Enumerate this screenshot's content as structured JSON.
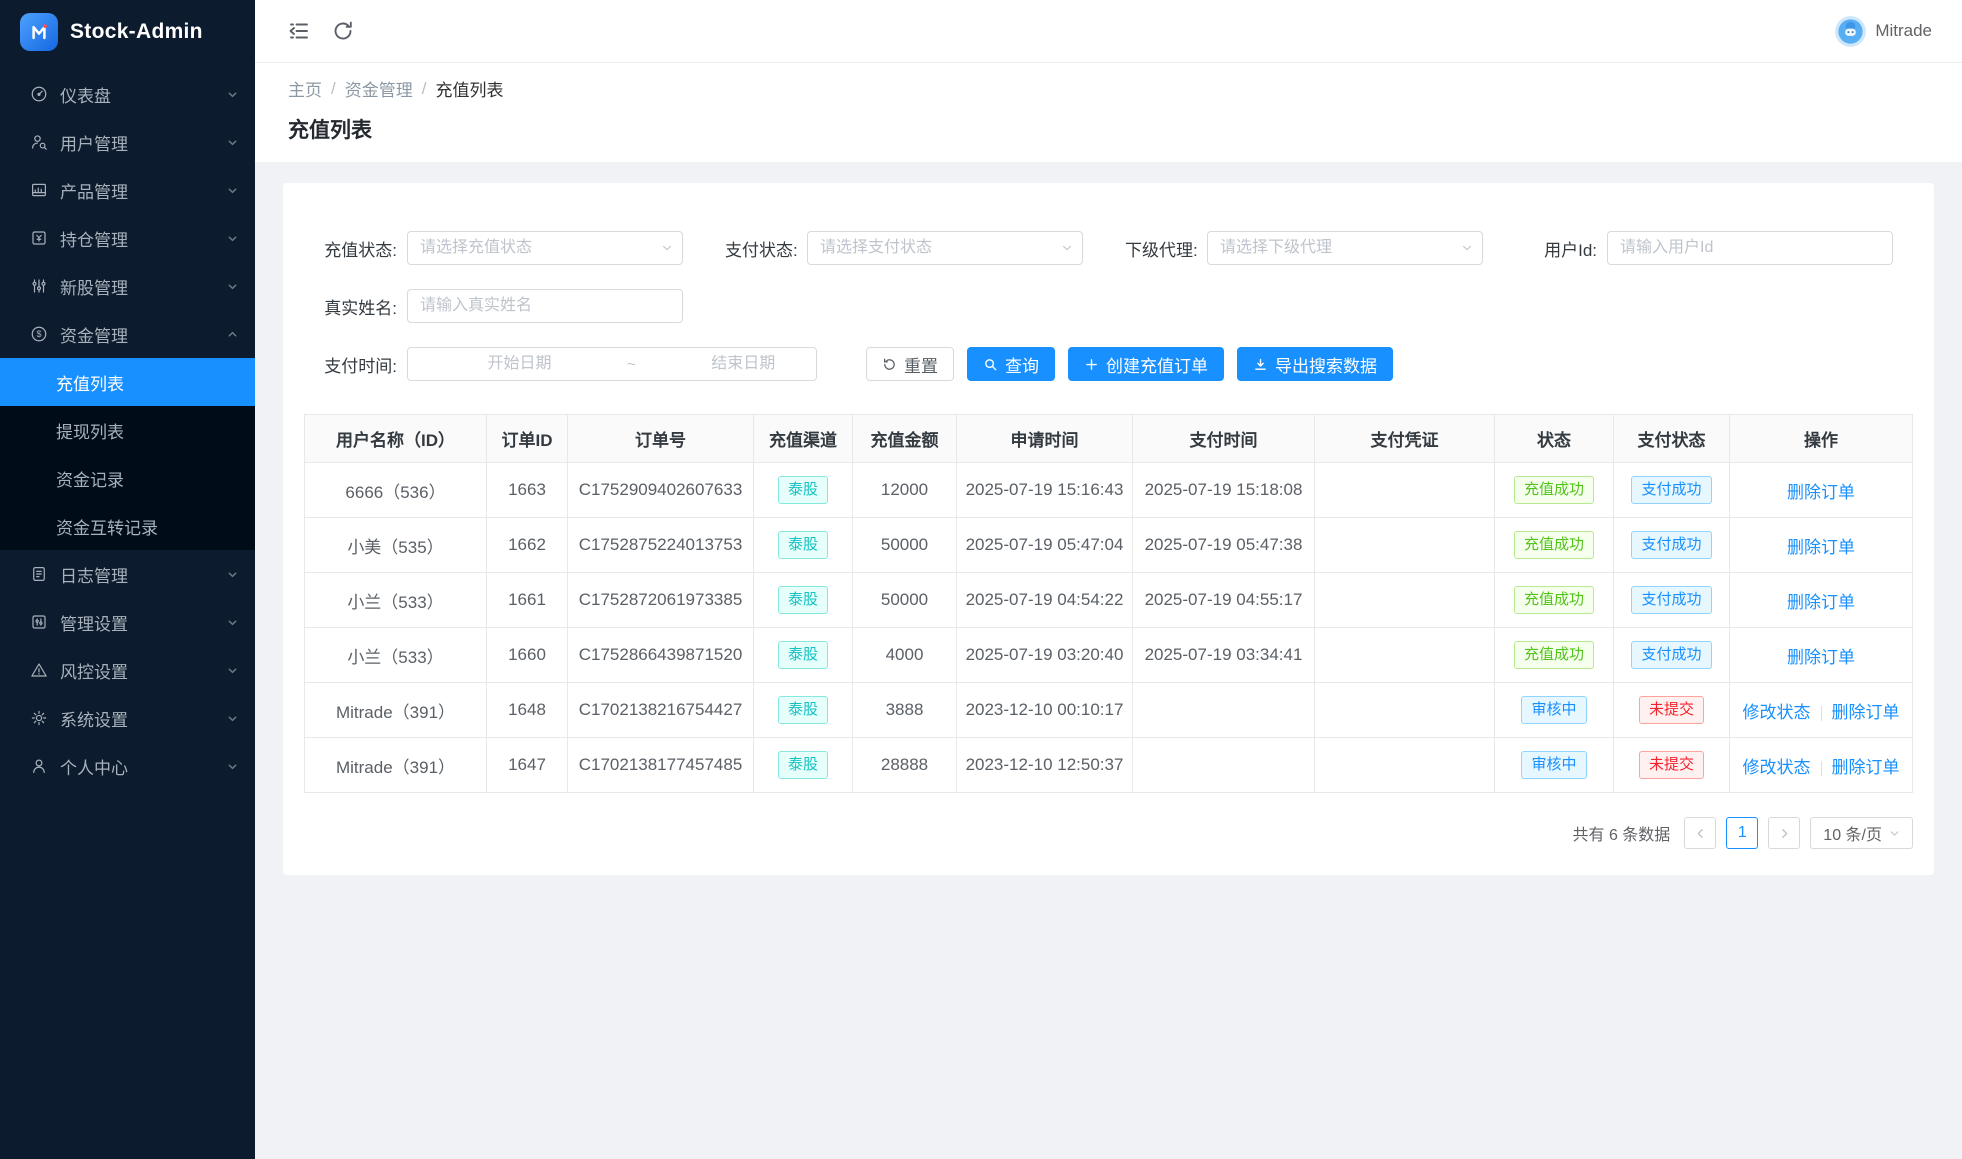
{
  "app": {
    "name": "Stock-Admin"
  },
  "topbar": {
    "username": "Mitrade"
  },
  "breadcrumb": {
    "items": [
      "主页",
      "资金管理",
      "充值列表"
    ],
    "separator": "/"
  },
  "page": {
    "title": "充值列表"
  },
  "sidebar": {
    "items": [
      {
        "label": "仪表盘"
      },
      {
        "label": "用户管理"
      },
      {
        "label": "产品管理"
      },
      {
        "label": "持仓管理"
      },
      {
        "label": "新股管理"
      },
      {
        "label": "资金管理"
      },
      {
        "label": "日志管理"
      },
      {
        "label": "管理设置"
      },
      {
        "label": "风控设置"
      },
      {
        "label": "系统设置"
      },
      {
        "label": "个人中心"
      }
    ],
    "funds_submenu": [
      {
        "label": "充值列表",
        "active": true
      },
      {
        "label": "提现列表",
        "active": false
      },
      {
        "label": "资金记录",
        "active": false
      },
      {
        "label": "资金互转记录",
        "active": false
      }
    ]
  },
  "filters": {
    "recharge_status": {
      "label": "充值状态:",
      "placeholder": "请选择充值状态"
    },
    "pay_status": {
      "label": "支付状态:",
      "placeholder": "请选择支付状态"
    },
    "agent": {
      "label": "下级代理:",
      "placeholder": "请选择下级代理"
    },
    "user_id": {
      "label": "用户Id:",
      "placeholder": "请输入用户Id"
    },
    "real_name": {
      "label": "真实姓名:",
      "placeholder": "请输入真实姓名"
    },
    "pay_time": {
      "label": "支付时间:",
      "start_placeholder": "开始日期",
      "separator": "~",
      "end_placeholder": "结束日期"
    }
  },
  "toolbar": {
    "reset_label": "重置",
    "search_label": "查询",
    "create_label": "创建充值订单",
    "export_label": "导出搜索数据"
  },
  "table": {
    "columns": [
      {
        "label": "用户名称（ID）",
        "key": "user",
        "type": "text"
      },
      {
        "label": "订单ID",
        "key": "order_id",
        "type": "text"
      },
      {
        "label": "订单号",
        "key": "order_no",
        "type": "text"
      },
      {
        "label": "充值渠道",
        "key": "channel",
        "type": "tag"
      },
      {
        "label": "充值金额",
        "key": "amount",
        "type": "text"
      },
      {
        "label": "申请时间",
        "key": "apply_time",
        "type": "text"
      },
      {
        "label": "支付时间",
        "key": "pay_time",
        "type": "text"
      },
      {
        "label": "支付凭证",
        "key": "voucher",
        "type": "text"
      },
      {
        "label": "状态",
        "key": "status",
        "type": "tag"
      },
      {
        "label": "支付状态",
        "key": "pay_status",
        "type": "tag"
      },
      {
        "label": "操作",
        "key": "actions",
        "type": "links"
      }
    ],
    "rows": [
      {
        "user": "6666（536）",
        "order_id": "1663",
        "order_no": "C1752909402607633",
        "channel": {
          "text": "泰股",
          "color": "cyan"
        },
        "amount": "12000",
        "apply_time": "2025-07-19 15:16:43",
        "pay_time": "2025-07-19 15:18:08",
        "voucher": "",
        "status": {
          "text": "充值成功",
          "color": "green"
        },
        "pay_status": {
          "text": "支付成功",
          "color": "blue"
        },
        "actions": [
          "删除订单"
        ]
      },
      {
        "user": "小美（535）",
        "order_id": "1662",
        "order_no": "C1752875224013753",
        "channel": {
          "text": "泰股",
          "color": "cyan"
        },
        "amount": "50000",
        "apply_time": "2025-07-19 05:47:04",
        "pay_time": "2025-07-19 05:47:38",
        "voucher": "",
        "status": {
          "text": "充值成功",
          "color": "green"
        },
        "pay_status": {
          "text": "支付成功",
          "color": "blue"
        },
        "actions": [
          "删除订单"
        ]
      },
      {
        "user": "小兰（533）",
        "order_id": "1661",
        "order_no": "C1752872061973385",
        "channel": {
          "text": "泰股",
          "color": "cyan"
        },
        "amount": "50000",
        "apply_time": "2025-07-19 04:54:22",
        "pay_time": "2025-07-19 04:55:17",
        "voucher": "",
        "status": {
          "text": "充值成功",
          "color": "green"
        },
        "pay_status": {
          "text": "支付成功",
          "color": "blue"
        },
        "actions": [
          "删除订单"
        ]
      },
      {
        "user": "小兰（533）",
        "order_id": "1660",
        "order_no": "C1752866439871520",
        "channel": {
          "text": "泰股",
          "color": "cyan"
        },
        "amount": "4000",
        "apply_time": "2025-07-19 03:20:40",
        "pay_time": "2025-07-19 03:34:41",
        "voucher": "",
        "status": {
          "text": "充值成功",
          "color": "green"
        },
        "pay_status": {
          "text": "支付成功",
          "color": "blue"
        },
        "actions": [
          "删除订单"
        ]
      },
      {
        "user": "Mitrade（391）",
        "order_id": "1648",
        "order_no": "C1702138216754427",
        "channel": {
          "text": "泰股",
          "color": "cyan"
        },
        "amount": "3888",
        "apply_time": "2023-12-10 00:10:17",
        "pay_time": "",
        "voucher": "",
        "status": {
          "text": "审核中",
          "color": "blue"
        },
        "pay_status": {
          "text": "未提交",
          "color": "red"
        },
        "actions": [
          "修改状态",
          "删除订单"
        ]
      },
      {
        "user": "Mitrade（391）",
        "order_id": "1647",
        "order_no": "C1702138177457485",
        "channel": {
          "text": "泰股",
          "color": "cyan"
        },
        "amount": "28888",
        "apply_time": "2023-12-10 12:50:37",
        "pay_time": "",
        "voucher": "",
        "status": {
          "text": "审核中",
          "color": "blue"
        },
        "pay_status": {
          "text": "未提交",
          "color": "red"
        },
        "actions": [
          "修改状态",
          "删除订单"
        ]
      }
    ]
  },
  "pagination": {
    "total_text": "共有 6 条数据",
    "current_page": "1",
    "page_size": "10 条/页"
  },
  "colors": {
    "primary": "#1890ff",
    "tag_cyan": "#13c2c2",
    "tag_green": "#52c41a",
    "tag_red": "#f5222d",
    "sidebar_bg": "#0c1b2d"
  }
}
